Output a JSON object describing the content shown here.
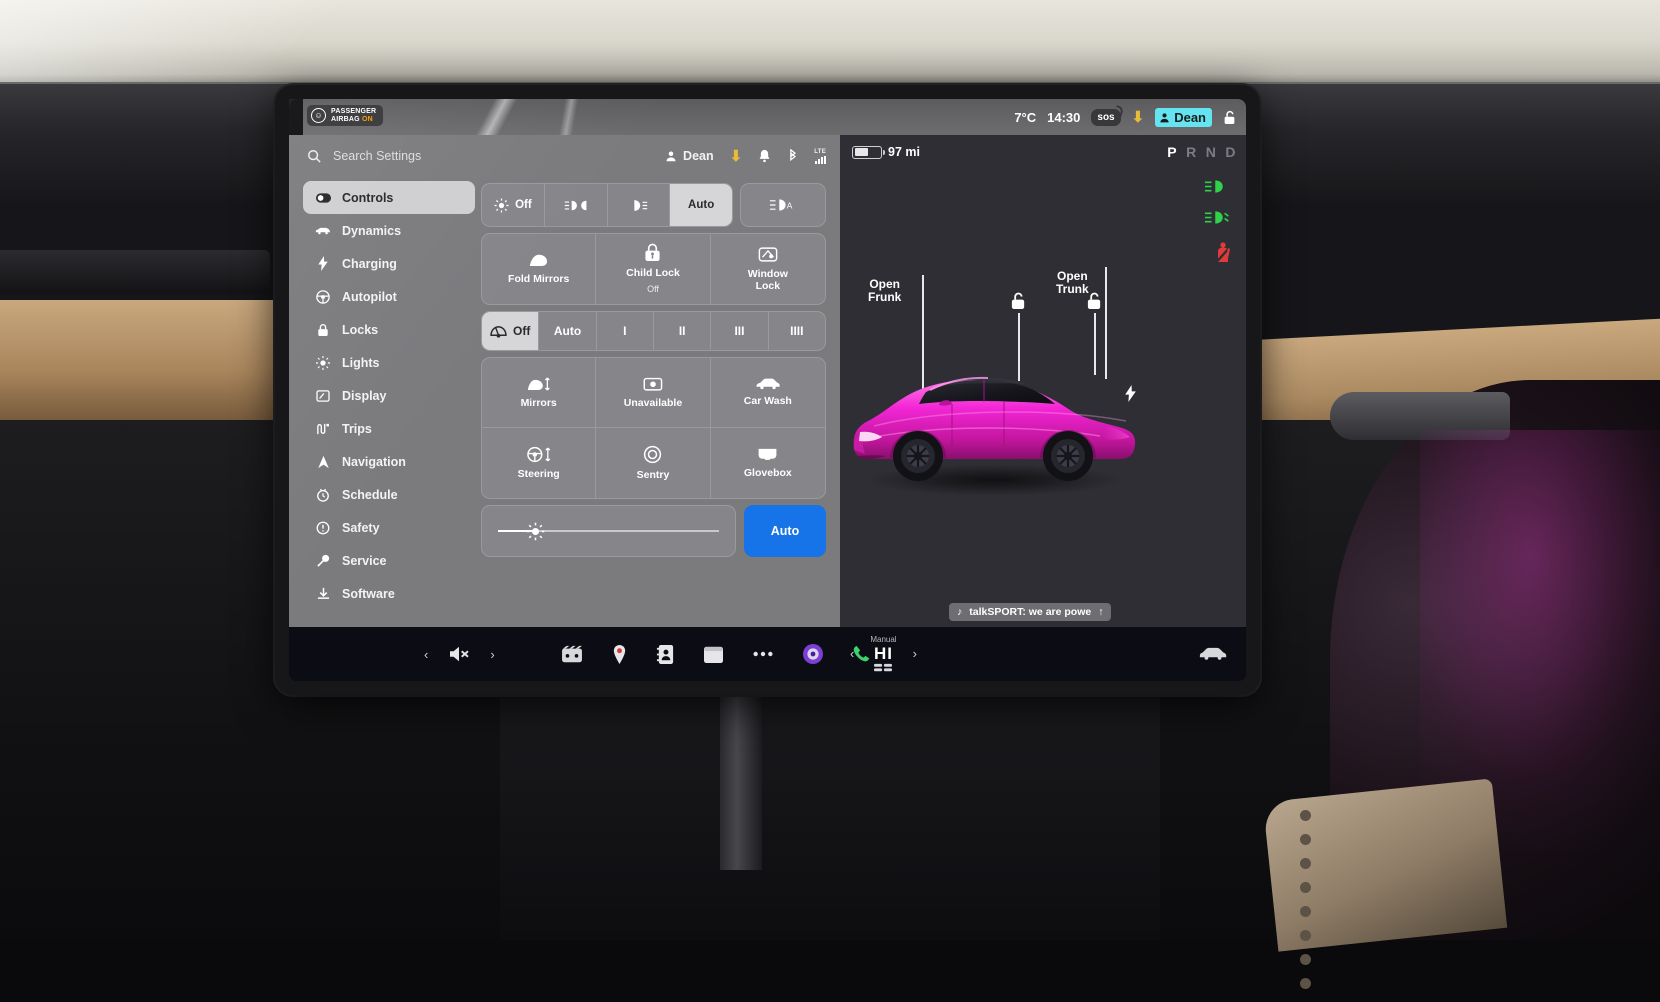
{
  "statusbar": {
    "airbag_line1": "PASSENGER",
    "airbag_line2_a": "AIRBAG ",
    "airbag_line2_b": "ON",
    "temperature": "7°C",
    "time": "14:30",
    "sos_label": "sos",
    "download_icon": "download-icon",
    "profile_name": "Dean",
    "lock_icon": "unlock-icon"
  },
  "settings": {
    "search_placeholder": "Search Settings",
    "profile_name": "Dean",
    "icons": {
      "search": "search-icon",
      "person": "person-icon",
      "download": "download-icon",
      "bell": "bell-icon",
      "bluetooth": "bluetooth-icon",
      "signal": "lte-signal-icon"
    },
    "signal_label": "LTE",
    "nav_items": [
      {
        "label": "Controls",
        "icon": "toggle-icon",
        "active": true
      },
      {
        "label": "Dynamics",
        "icon": "car-icon",
        "active": false
      },
      {
        "label": "Charging",
        "icon": "bolt-icon",
        "active": false
      },
      {
        "label": "Autopilot",
        "icon": "steering-icon",
        "active": false
      },
      {
        "label": "Locks",
        "icon": "lock-icon",
        "active": false
      },
      {
        "label": "Lights",
        "icon": "sun-icon",
        "active": false
      },
      {
        "label": "Display",
        "icon": "display-icon",
        "active": false
      },
      {
        "label": "Trips",
        "icon": "trips-icon",
        "active": false
      },
      {
        "label": "Navigation",
        "icon": "navigation-icon",
        "active": false
      },
      {
        "label": "Schedule",
        "icon": "clock-icon",
        "active": false
      },
      {
        "label": "Safety",
        "icon": "warning-icon",
        "active": false
      },
      {
        "label": "Service",
        "icon": "wrench-icon",
        "active": false
      },
      {
        "label": "Software",
        "icon": "software-icon",
        "active": false
      }
    ],
    "lights_segment": [
      {
        "label": "Off",
        "icon": "light-off-icon",
        "selected": false
      },
      {
        "label": "",
        "icon": "parking-light-icon",
        "selected": false
      },
      {
        "label": "",
        "icon": "low-beam-icon",
        "selected": false
      },
      {
        "label": "Auto",
        "icon": "",
        "selected": true
      }
    ],
    "auto_highbeam": {
      "icon": "auto-high-beam-icon",
      "label": ""
    },
    "tiles_row1": [
      {
        "label": "Fold Mirrors",
        "sub": "",
        "icon": "mirror-icon"
      },
      {
        "label": "Child Lock",
        "sub": "Off",
        "icon": "child-lock-icon"
      },
      {
        "label": "Window\nLock",
        "sub": "",
        "icon": "window-lock-icon"
      }
    ],
    "wiper_segment": [
      {
        "label": "Off",
        "icon": "wiper-icon",
        "selected": true
      },
      {
        "label": "Auto",
        "icon": "",
        "selected": false
      },
      {
        "label": "I",
        "icon": "",
        "selected": false
      },
      {
        "label": "II",
        "icon": "",
        "selected": false
      },
      {
        "label": "III",
        "icon": "",
        "selected": false
      },
      {
        "label": "IIII",
        "icon": "",
        "selected": false
      }
    ],
    "tiles_grid": [
      {
        "label": "Mirrors",
        "icon": "mirror-adjust-icon"
      },
      {
        "label": "Unavailable",
        "icon": "camera-icon"
      },
      {
        "label": "Car Wash",
        "icon": "car-wash-icon"
      },
      {
        "label": "Steering",
        "icon": "steering-adjust-icon"
      },
      {
        "label": "Sentry",
        "icon": "sentry-icon"
      },
      {
        "label": "Glovebox",
        "icon": "glovebox-icon"
      }
    ],
    "brightness": {
      "icon": "brightness-icon",
      "value_percent": 17
    },
    "auto_button": "Auto"
  },
  "visualizer": {
    "battery_range": "97 mi",
    "battery_percent": 55,
    "gear_letters": [
      "P",
      "R",
      "N",
      "D"
    ],
    "gear_current": "P",
    "telltales": [
      {
        "name": "low-beam-telltale",
        "color": "#2ed34a"
      },
      {
        "name": "fog-light-telltale",
        "color": "#2ed34a"
      },
      {
        "name": "seatbelt-telltale",
        "color": "#e03a3a"
      }
    ],
    "frunk_label_line1": "Open",
    "frunk_label_line2": "Frunk",
    "trunk_label_line1": "Open",
    "trunk_label_line2": "Trunk",
    "unlock_icon": "unlock-icon",
    "charge_port_icon": "bolt-icon",
    "car_color": "#e81fd0"
  },
  "taskbar": {
    "volume_icon": "volume-mute-icon",
    "prev_icon": "chevron-left-icon",
    "next_icon": "chevron-right-icon",
    "apps": [
      {
        "name": "media-app-icon"
      },
      {
        "name": "navigation-pin-icon"
      },
      {
        "name": "phone-contacts-icon"
      },
      {
        "name": "calendar-app-icon"
      },
      {
        "name": "more-apps-icon"
      },
      {
        "name": "browser-app-icon"
      },
      {
        "name": "phone-app-icon"
      }
    ],
    "media_chip": {
      "icon": "music-note-icon",
      "text": "talkSPORT: we are powe",
      "expand_icon": "chevron-up-icon"
    },
    "climate": {
      "prev_icon": "chevron-left-icon",
      "mode_label": "Manual",
      "temperature": "HI",
      "next_icon": "chevron-right-icon",
      "seat_icon": "seat-heater-icon",
      "car_icon": "climate-car-icon"
    }
  }
}
